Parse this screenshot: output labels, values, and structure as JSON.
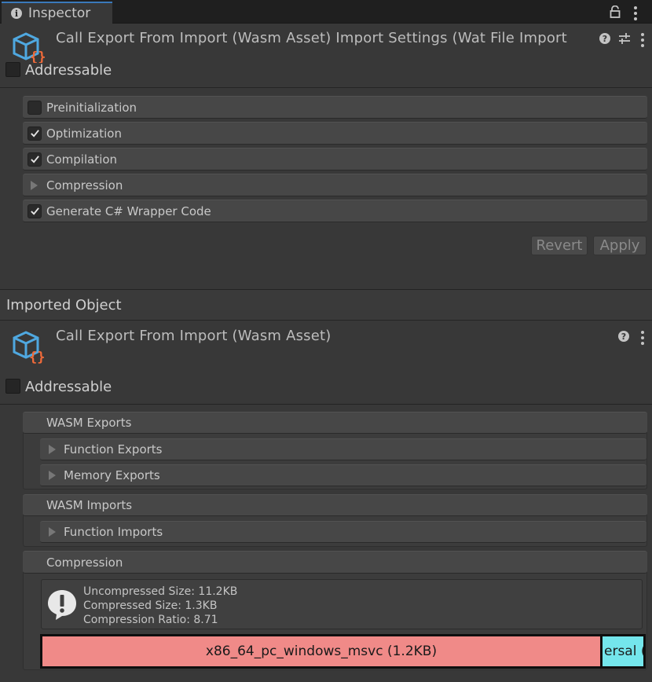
{
  "tab": {
    "title": "Inspector"
  },
  "header1": {
    "title": "Call Export From Import (Wasm Asset) Import Settings (Wat File Import",
    "addressable_label": "Addressable"
  },
  "import_settings": {
    "rows": [
      {
        "label": "Preinitialization",
        "checked": false
      },
      {
        "label": "Optimization",
        "checked": true
      },
      {
        "label": "Compilation",
        "checked": true
      },
      {
        "label": "Compression",
        "foldout": true
      },
      {
        "label": "Generate C# Wrapper Code",
        "checked": true
      }
    ],
    "revert_label": "Revert",
    "apply_label": "Apply"
  },
  "imported_object": {
    "label": "Imported Object"
  },
  "header2": {
    "title": "Call Export From Import (Wasm Asset)",
    "addressable_label": "Addressable"
  },
  "wasm_exports": {
    "title": "WASM Exports",
    "items": [
      "Function Exports",
      "Memory Exports"
    ]
  },
  "wasm_imports": {
    "title": "WASM Imports",
    "items": [
      "Function Imports"
    ]
  },
  "compression": {
    "title": "Compression",
    "lines": [
      "Uncompressed Size: 11.2KB",
      "Compressed Size: 1.3KB",
      "Compression Ratio: 8.71"
    ],
    "bar_primary": "x86_64_pc_windows_msvc (1.2KB)",
    "bar_secondary": "ersal ("
  },
  "colors": {
    "accent": "#3a79bb",
    "icon_blue": "#4fa8e0",
    "icon_orange": "#f26b3a",
    "bar_red": "#f08a88",
    "bar_cyan": "#74e6ec"
  }
}
